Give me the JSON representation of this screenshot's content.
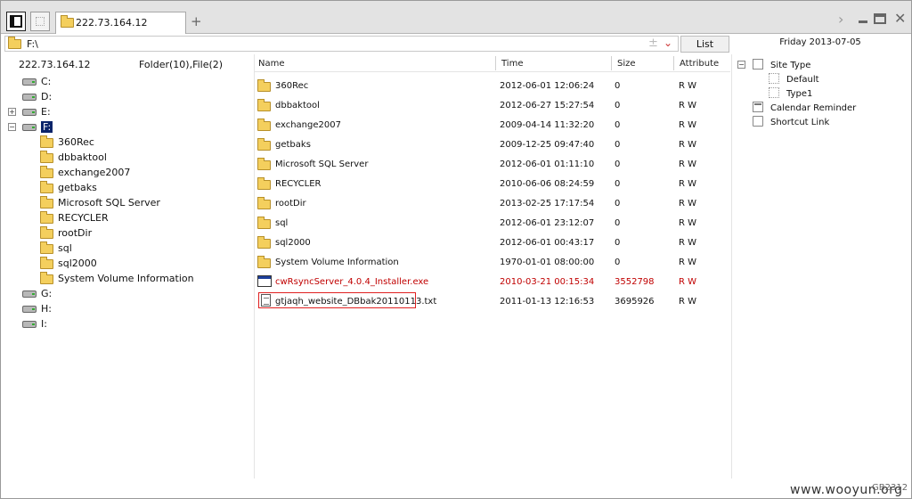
{
  "tab": {
    "title": "222.73.164.12",
    "add_symbol": "+"
  },
  "window_controls": {
    "forward": "›",
    "close": "✕"
  },
  "address": {
    "path": "F:\\",
    "plus_symbol": "±",
    "dropdown_symbol": "⌄"
  },
  "toolbar": {
    "list_label": "List"
  },
  "date_label": "Friday 2013-07-05",
  "left": {
    "host": "222.73.164.12",
    "counts": "Folder(10),File(2)",
    "drives": [
      {
        "label": "C:",
        "expander": ""
      },
      {
        "label": "D:",
        "expander": ""
      },
      {
        "label": "E:",
        "expander": "+"
      },
      {
        "label": "F:",
        "expander": "−"
      },
      {
        "label": "G:",
        "expander": ""
      },
      {
        "label": "H:",
        "expander": ""
      },
      {
        "label": "I:",
        "expander": ""
      }
    ],
    "folders": [
      "360Rec",
      "dbbaktool",
      "exchange2007",
      "getbaks",
      "Microsoft SQL Server",
      "RECYCLER",
      "rootDir",
      "sql",
      "sql2000",
      "System Volume Information"
    ]
  },
  "columns": {
    "name": "Name",
    "time": "Time",
    "size": "Size",
    "attribute": "Attribute"
  },
  "files": [
    {
      "name": "360Rec",
      "time": "2012-06-01 12:06:24",
      "size": "0",
      "attr": "R W",
      "type": "folder"
    },
    {
      "name": "dbbaktool",
      "time": "2012-06-27 15:27:54",
      "size": "0",
      "attr": "R W",
      "type": "folder"
    },
    {
      "name": "exchange2007",
      "time": "2009-04-14 11:32:20",
      "size": "0",
      "attr": "R W",
      "type": "folder"
    },
    {
      "name": "getbaks",
      "time": "2009-12-25 09:47:40",
      "size": "0",
      "attr": "R W",
      "type": "folder"
    },
    {
      "name": "Microsoft SQL Server",
      "time": "2012-06-01 01:11:10",
      "size": "0",
      "attr": "R W",
      "type": "folder"
    },
    {
      "name": "RECYCLER",
      "time": "2010-06-06 08:24:59",
      "size": "0",
      "attr": "R W",
      "type": "folder"
    },
    {
      "name": "rootDir",
      "time": "2013-02-25 17:17:54",
      "size": "0",
      "attr": "R W",
      "type": "folder"
    },
    {
      "name": "sql",
      "time": "2012-06-01 23:12:07",
      "size": "0",
      "attr": "R W",
      "type": "folder"
    },
    {
      "name": "sql2000",
      "time": "2012-06-01 00:43:17",
      "size": "0",
      "attr": "R W",
      "type": "folder"
    },
    {
      "name": "System Volume Information",
      "time": "1970-01-01 08:00:00",
      "size": "0",
      "attr": "R W",
      "type": "folder"
    },
    {
      "name": "cwRsyncServer_4.0.4_Installer.exe",
      "time": "2010-03-21 00:15:34",
      "size": "3552798",
      "attr": "R W",
      "type": "exe",
      "color": "#c00000"
    },
    {
      "name": "gtjaqh_website_DBbak20110113.txt",
      "time": "2011-01-13 12:16:53",
      "size": "3695926",
      "attr": "R W",
      "type": "txt",
      "highlight": "#e02020"
    }
  ],
  "right_tree": {
    "site_type": "Site Type",
    "site_type_expander": "−",
    "site_children": [
      "Default",
      "Type1"
    ],
    "calendar": "Calendar Reminder",
    "shortcut": "Shortcut Link"
  },
  "status": "GB2312",
  "watermark": "www.wooyun.org"
}
